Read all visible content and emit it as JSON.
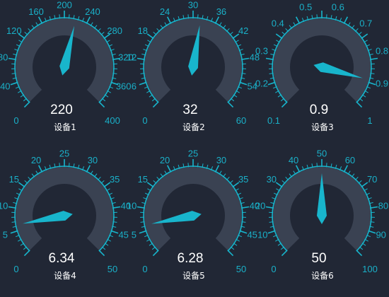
{
  "colors": {
    "background": "#212735",
    "track": "#3a4252",
    "accent": "#18b5cc",
    "text": "#ffffff"
  },
  "gauges": [
    {
      "device": "设备1",
      "value_display": "220",
      "value": 220,
      "min": 0,
      "max": 400,
      "end_labels": [
        "0",
        "400"
      ],
      "tick_labels": [
        "40",
        "80",
        "120",
        "160",
        "200",
        "240",
        "280",
        "320",
        "360"
      ]
    },
    {
      "device": "设备2",
      "value_display": "32",
      "value": 32,
      "min": 0,
      "max": 60,
      "end_labels": [
        "0",
        "60"
      ],
      "tick_labels": [
        "6",
        "12",
        "18",
        "24",
        "30",
        "36",
        "42",
        "48",
        "54"
      ]
    },
    {
      "device": "设备3",
      "value_display": "0.9",
      "value": 0.9,
      "min": 0.1,
      "max": 1,
      "end_labels": [
        "0.1",
        "1"
      ],
      "tick_labels": [
        "0.2",
        "0.3",
        "0.4",
        "0.5",
        "0.6",
        "0.7",
        "0.8",
        "0.9"
      ]
    },
    {
      "device": "设备4",
      "value_display": "6.34",
      "value": 6.34,
      "min": 0,
      "max": 50,
      "end_labels": [
        "0",
        "50"
      ],
      "tick_labels": [
        "5",
        "10",
        "15",
        "20",
        "25",
        "30",
        "35",
        "40",
        "45"
      ]
    },
    {
      "device": "设备5",
      "value_display": "6.28",
      "value": 6.28,
      "min": 0,
      "max": 50,
      "end_labels": [
        "0",
        "50"
      ],
      "tick_labels": [
        "5",
        "10",
        "15",
        "20",
        "25",
        "30",
        "35",
        "40",
        "45"
      ]
    },
    {
      "device": "设备6",
      "value_display": "50",
      "value": 50,
      "min": 0,
      "max": 100,
      "end_labels": [
        "0",
        "100"
      ],
      "tick_labels": [
        "10",
        "20",
        "30",
        "40",
        "50",
        "60",
        "70",
        "80",
        "90"
      ]
    }
  ]
}
